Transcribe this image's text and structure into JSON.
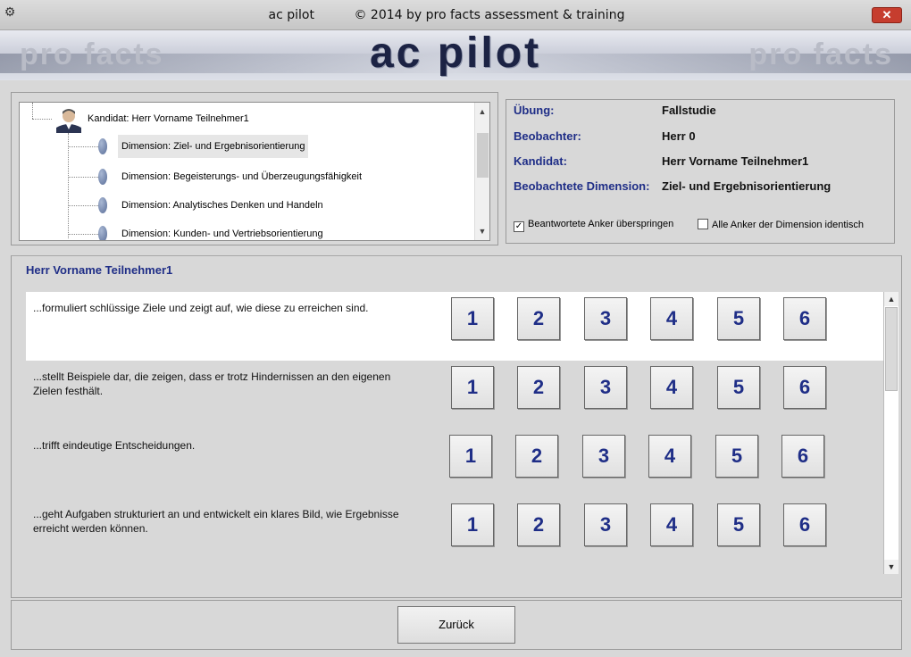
{
  "window": {
    "app_icon": "app-icon",
    "title": "ac pilot          © 2014 by pro facts assessment & training",
    "close_label": "✕"
  },
  "banner": {
    "left_text": "pro facts",
    "center_text": "ac pilot",
    "right_text": "pro facts"
  },
  "tree": {
    "root_label": "Kandidat: Herr Vorname Teilnehmer1",
    "root_icon": "person-avatar-icon",
    "items": [
      {
        "label": "Dimension: Ziel- und Ergebnisorientierung",
        "selected": true
      },
      {
        "label": "Dimension: Begeisterungs- und Überzeugungsfähigkeit",
        "selected": false
      },
      {
        "label": "Dimension: Analytisches Denken und Handeln",
        "selected": false
      },
      {
        "label": "Dimension: Kunden- und Vertriebsorientierung",
        "selected": false
      }
    ]
  },
  "info": {
    "uebung_key": "Übung:",
    "uebung_val": "Fallstudie",
    "beobachter_key": "Beobachter:",
    "beobachter_val": "Herr 0",
    "kandidat_key": "Kandidat:",
    "kandidat_val": "Herr Vorname Teilnehmer1",
    "dimension_key": "Beobachtete Dimension:",
    "dimension_val": "Ziel- und Ergebnisorientierung",
    "skip_label": "Beantwortete Anker überspringen",
    "skip_checked": true,
    "identical_label": "Alle Anker der Dimension identisch",
    "identical_checked": false
  },
  "main": {
    "candidate_header": "Herr Vorname Teilnehmer1",
    "anchors": [
      {
        "text": "...formuliert schlüssige Ziele und zeigt auf, wie diese zu erreichen sind.",
        "active": true
      },
      {
        "text": "...stellt Beispiele dar, die zeigen, dass er trotz Hindernissen an den eigenen Zielen festhält.",
        "active": false
      },
      {
        "text": "...trifft eindeutige Entscheidungen.",
        "active": false
      },
      {
        "text": "...geht Aufgaben strukturiert an und entwickelt ein klares Bild, wie Ergebnisse erreicht werden können.",
        "active": false
      }
    ],
    "scores": [
      "1",
      "2",
      "3",
      "4",
      "5",
      "6"
    ]
  },
  "footer": {
    "back_label": "Zurück"
  },
  "colors": {
    "accent_blue": "#1f2e87",
    "background": "#d8d8d8"
  }
}
